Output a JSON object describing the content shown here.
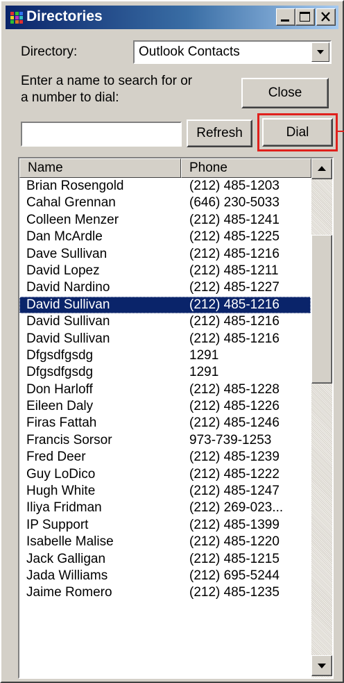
{
  "window": {
    "title": "Directories"
  },
  "directory": {
    "label": "Directory:",
    "selected": "Outlook Contacts"
  },
  "search": {
    "prompt_line1": "Enter a name to search for or",
    "prompt_line2": "a number to dial:",
    "value": ""
  },
  "buttons": {
    "close": "Close",
    "refresh": "Refresh",
    "dial": "Dial"
  },
  "list": {
    "headers": {
      "name": "Name",
      "phone": "Phone"
    },
    "rows": [
      {
        "name": "Brian Rosengold",
        "phone": "(212) 485-1203"
      },
      {
        "name": "Cahal Grennan",
        "phone": "(646) 230-5033"
      },
      {
        "name": "Colleen Menzer",
        "phone": "(212) 485-1241"
      },
      {
        "name": "Dan McArdle",
        "phone": "(212) 485-1225"
      },
      {
        "name": "Dave Sullivan",
        "phone": "(212) 485-1216"
      },
      {
        "name": "David Lopez",
        "phone": "(212) 485-1211"
      },
      {
        "name": "David Nardino",
        "phone": "(212) 485-1227"
      },
      {
        "name": "David Sullivan",
        "phone": "(212) 485-1216"
      },
      {
        "name": "David Sullivan",
        "phone": "(212) 485-1216"
      },
      {
        "name": "David Sullivan",
        "phone": "(212) 485-1216"
      },
      {
        "name": "Dfgsdfgsdg",
        "phone": "1291"
      },
      {
        "name": "Dfgsdfgsdg",
        "phone": "1291"
      },
      {
        "name": "Don Harloff",
        "phone": "(212) 485-1228"
      },
      {
        "name": "Eileen Daly",
        "phone": "(212) 485-1226"
      },
      {
        "name": "Firas Fattah",
        "phone": "(212) 485-1246"
      },
      {
        "name": "Francis Sorsor",
        "phone": "973-739-1253"
      },
      {
        "name": "Fred Deer",
        "phone": "(212) 485-1239"
      },
      {
        "name": "Guy LoDico",
        "phone": "(212) 485-1222"
      },
      {
        "name": "Hugh White",
        "phone": "(212) 485-1247"
      },
      {
        "name": "Iliya Fridman",
        "phone": "(212) 269-023..."
      },
      {
        "name": "IP Support",
        "phone": "(212) 485-1399"
      },
      {
        "name": "Isabelle Malise",
        "phone": "(212) 485-1220"
      },
      {
        "name": "Jack Galligan",
        "phone": "(212) 485-1215"
      },
      {
        "name": "Jada Williams",
        "phone": "(212) 695-5244"
      },
      {
        "name": "Jaime Romero",
        "phone": "(212) 485-1235"
      }
    ],
    "selected_row_index": 7
  },
  "colors": {
    "selection": "#0a246a",
    "highlight": "#e0201c",
    "face": "#d4d0c8"
  }
}
